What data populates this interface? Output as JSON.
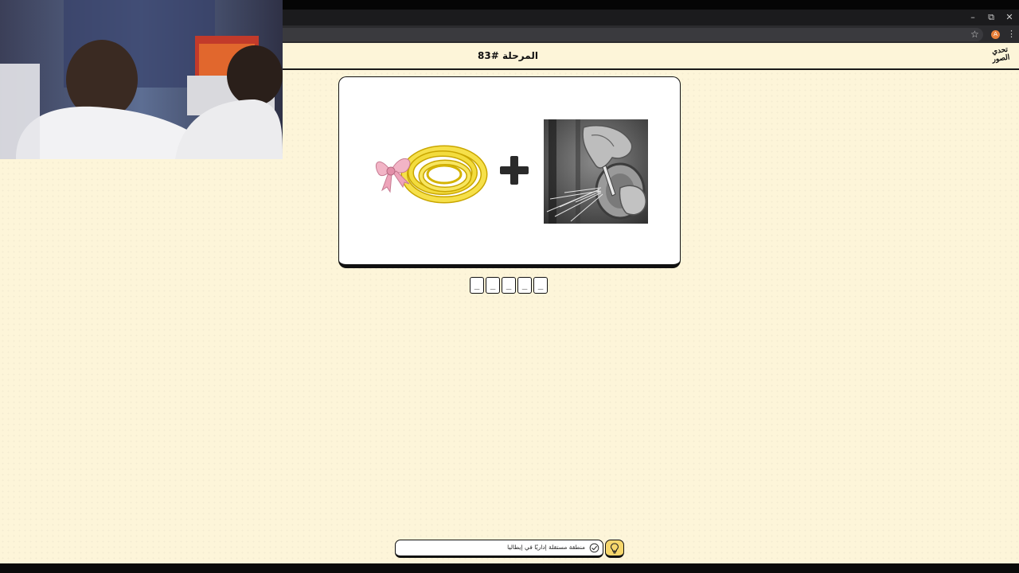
{
  "browser": {
    "window_controls": {
      "minimize": "–",
      "restore": "⧉",
      "close": "✕"
    },
    "profile_initial": "A",
    "star_glyph": "☆",
    "menu_glyph": "⋮"
  },
  "header": {
    "stage_title": "المرحلة #83",
    "logo_text": "تحدي الصور"
  },
  "puzzle": {
    "images": [
      "hose-with-bow",
      "grinding-wheel-sparks"
    ],
    "operator": "+"
  },
  "answer": {
    "slots": [
      "_",
      "_",
      "_",
      "_",
      "_"
    ]
  },
  "hint": {
    "text": "منطقة مستقلة إداريًا في إيطاليا"
  },
  "icons": {
    "hint_button": "lightbulb-icon",
    "hint_status": "check-circle-icon"
  },
  "colors": {
    "page_background": "#fdf5d9",
    "hint_button": "#f7d76c",
    "border": "#111111"
  }
}
